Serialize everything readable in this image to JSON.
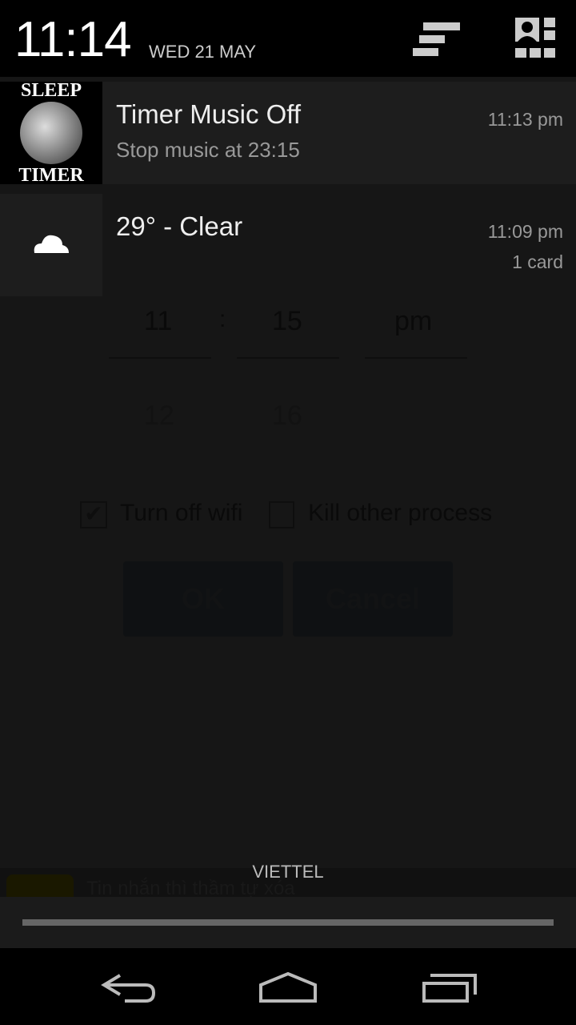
{
  "status": {
    "time": "11:14",
    "date": "WED 21 MAY"
  },
  "notifications": [
    {
      "title": "Timer Music Off",
      "text": "Stop music at 23:15",
      "time": "11:13 pm",
      "icon": "sleep-timer-app-icon",
      "icon_text": "SLEEP TIMER"
    },
    {
      "title": "29° - Clear",
      "time": "11:09 pm",
      "count": "1 card",
      "icon": "cloud-icon"
    }
  ],
  "background_app": {
    "hour": "11",
    "separator": ":",
    "minute": "15",
    "ampm": "pm",
    "next_hour": "12",
    "next_minute": "16",
    "wifi_label": "Turn off wifi",
    "wifi_checked": true,
    "kill_label": "Kill other process",
    "kill_checked": false,
    "ok_label": "OK",
    "cancel_label": "Cancel",
    "ad_text": "Tin nhắn thì thầm tự xóa"
  },
  "carrier": "VIETTEL"
}
